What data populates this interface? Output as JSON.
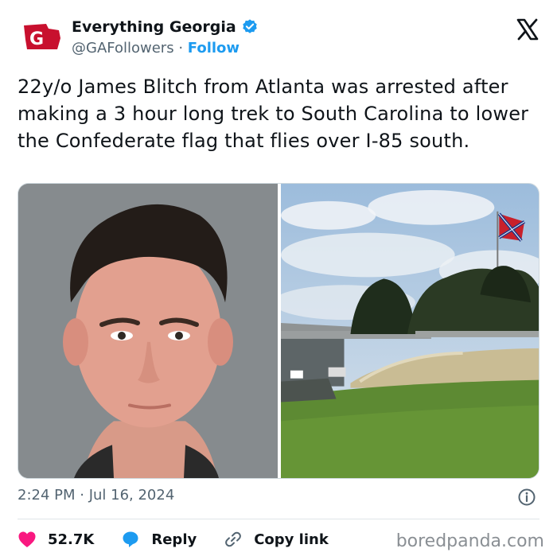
{
  "account": {
    "display_name": "Everything Georgia",
    "handle": "@GAFollowers",
    "separator": "·",
    "follow_label": "Follow",
    "avatar_text": "G",
    "verified": true
  },
  "tweet": {
    "text": "22y/o James Blitch from Atlanta was arrested after making a 3 hour long trek to South Carolina to lower the Confederate flag that flies over I-85 south.",
    "timestamp": "2:24 PM · Jul 16, 2024"
  },
  "actions": {
    "likes": "52.7K",
    "reply_label": "Reply",
    "copy_link_label": "Copy link"
  },
  "watermark": "boredpanda.com",
  "icons": {
    "brand": "x-logo-icon",
    "verified": "verified-badge-icon",
    "info": "info-icon",
    "like": "heart-icon",
    "reply": "speech-bubble-icon",
    "copy": "link-icon"
  },
  "colors": {
    "accent": "#1d9bf0",
    "like": "#f91880",
    "text": "#0f1419",
    "muted": "#536471",
    "avatar_red": "#c8102e"
  }
}
